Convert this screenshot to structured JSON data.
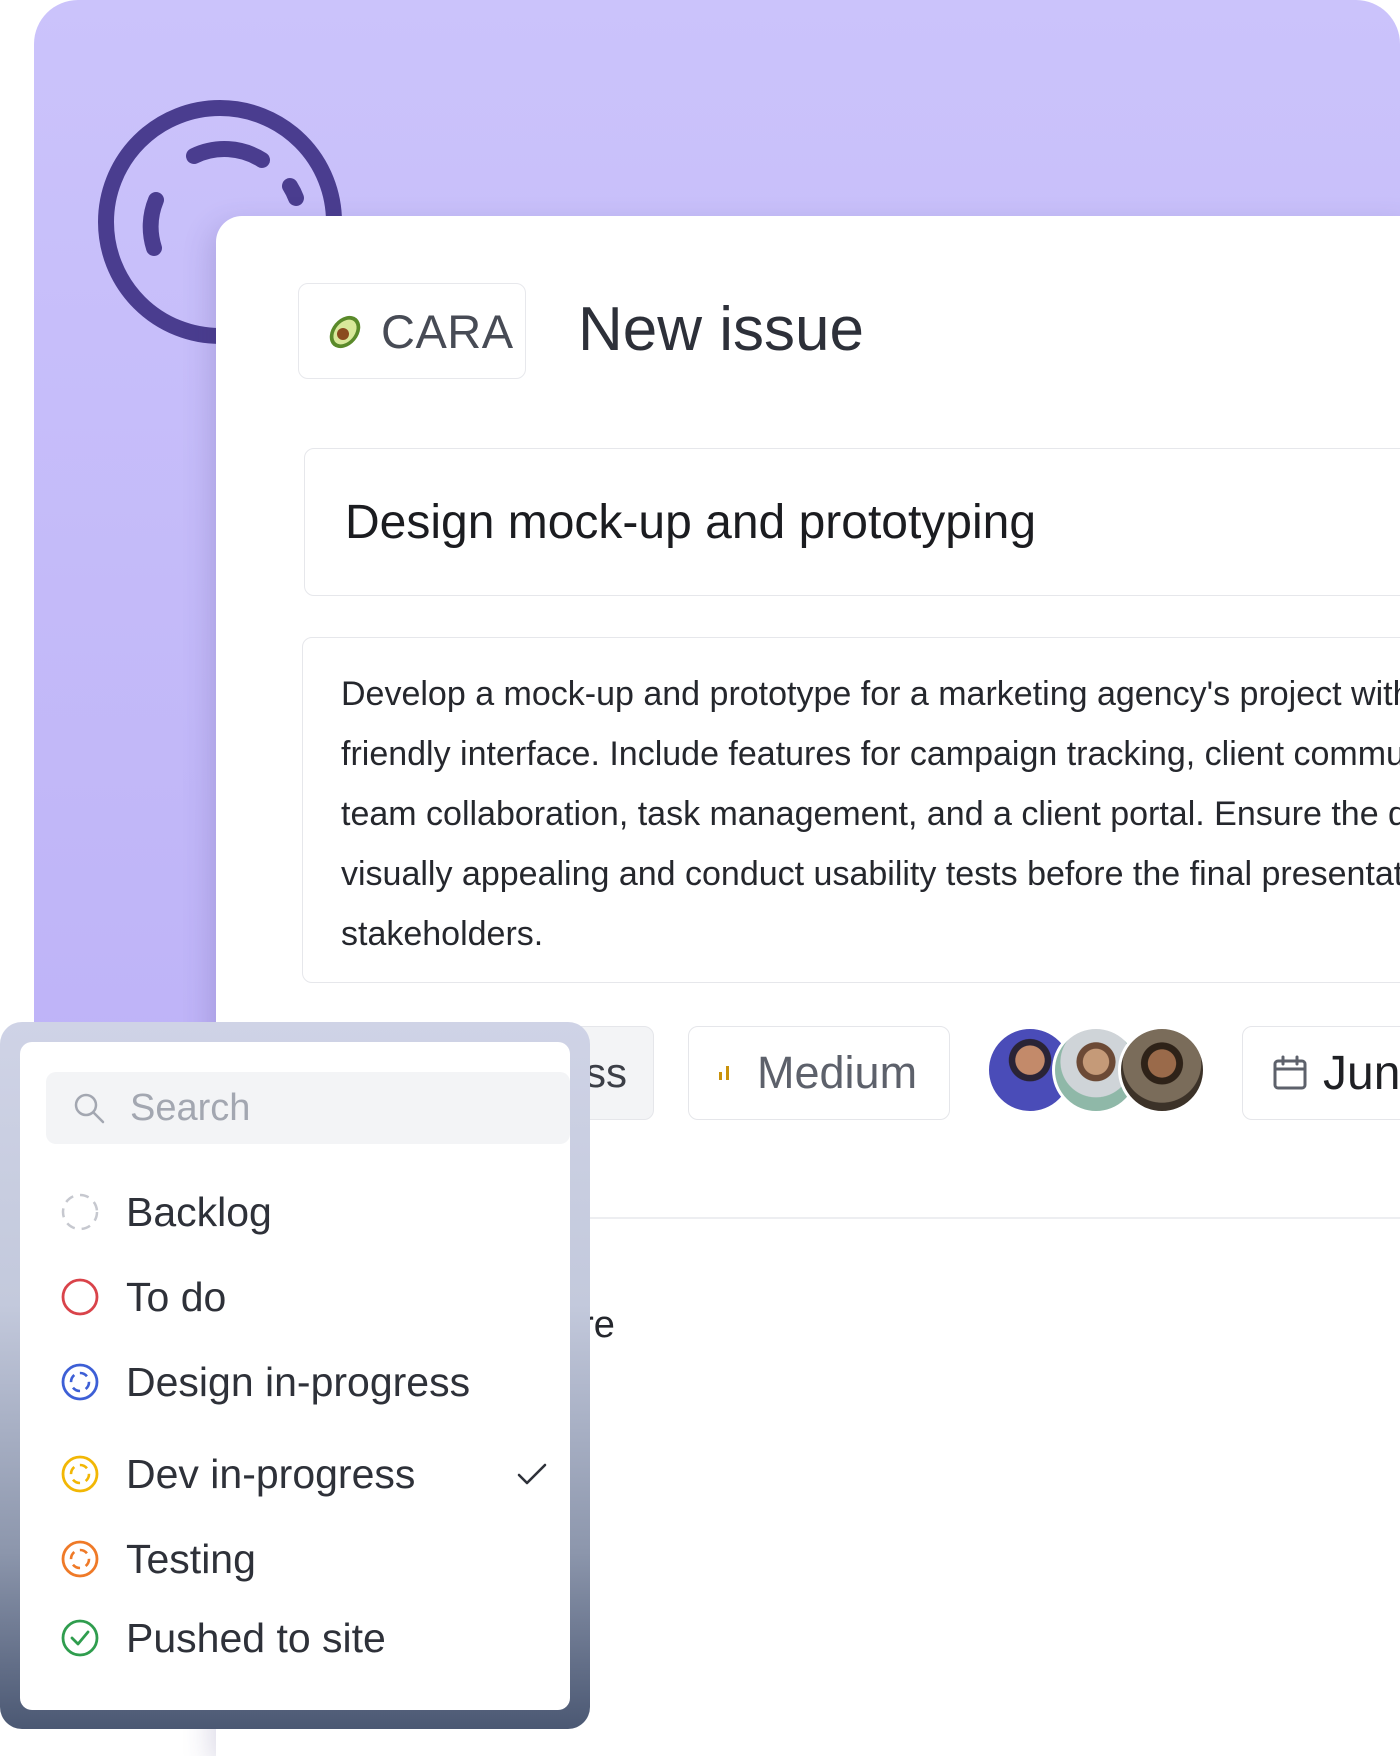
{
  "project": {
    "name": "CARA",
    "icon": "avocado-icon"
  },
  "page_title": "New issue",
  "issue": {
    "title": "Design mock-up and prototyping",
    "description": "Develop a mock-up and prototype for a marketing agency's project  with a user-friendly interface. Include features for campaign tracking, client communication, team collaboration, task management, and a client portal. Ensure the design is visually appealing and conduct usability tests before the final presentation to stakeholders."
  },
  "properties": {
    "status_partial": "ss",
    "priority": {
      "label": "Medium",
      "icon": "priority-bars-icon",
      "color": "#c9920c"
    },
    "assignees": [
      "avatar-1",
      "avatar-2",
      "avatar-3"
    ],
    "due_date_partial": "Jun"
  },
  "body_partial": "ore",
  "status_dropdown": {
    "search_placeholder": "Search",
    "options": [
      {
        "label": "Backlog",
        "icon": "backlog-dashed-circle-icon",
        "color": "#c6c8cf",
        "selected": false
      },
      {
        "label": "To do",
        "icon": "todo-circle-icon",
        "color": "#d9434a",
        "selected": false
      },
      {
        "label": "Design in-progress",
        "icon": "progress-circle-icon",
        "color": "#3d5fd6",
        "selected": false
      },
      {
        "label": "Dev in-progress",
        "icon": "progress-circle-icon",
        "color": "#f2b705",
        "selected": true
      },
      {
        "label": "Testing",
        "icon": "progress-circle-icon",
        "color": "#ef7a28",
        "selected": false
      },
      {
        "label": "Pushed to site",
        "icon": "check-circle-icon",
        "color": "#2f9d4e",
        "selected": false
      }
    ]
  },
  "colors": {
    "background_accent": "#c4bbf9",
    "logo_stroke": "#4a3d8f"
  }
}
